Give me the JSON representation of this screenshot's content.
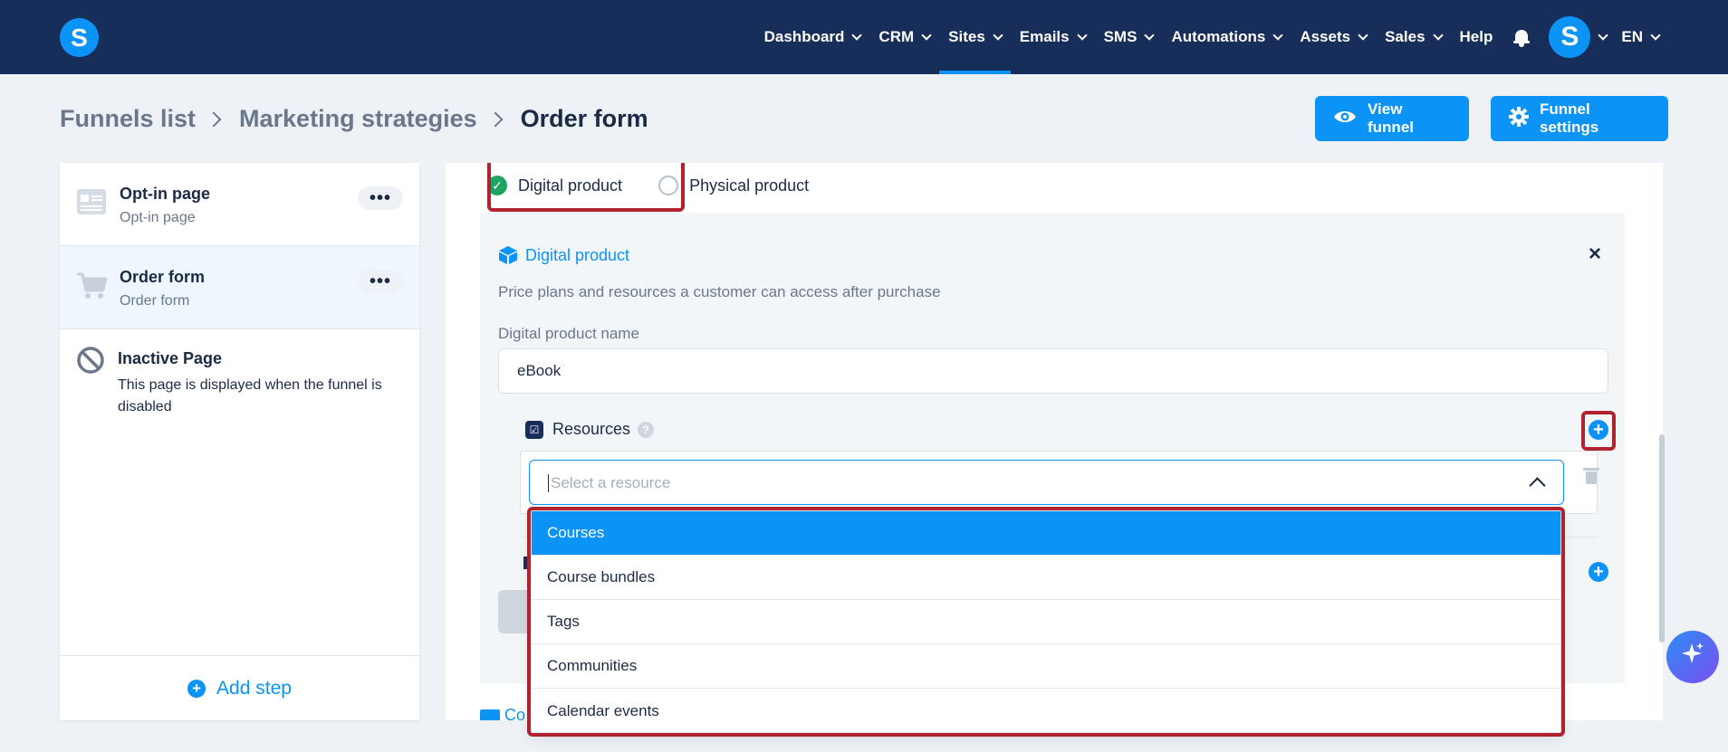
{
  "app": {
    "logo_letter": "S"
  },
  "nav": {
    "items": [
      {
        "label": "Dashboard",
        "dropdown": true
      },
      {
        "label": "CRM",
        "dropdown": true
      },
      {
        "label": "Sites",
        "dropdown": true,
        "active": true
      },
      {
        "label": "Emails",
        "dropdown": true
      },
      {
        "label": "SMS",
        "dropdown": true
      },
      {
        "label": "Automations",
        "dropdown": true
      },
      {
        "label": "Assets",
        "dropdown": true
      },
      {
        "label": "Sales",
        "dropdown": true
      },
      {
        "label": "Help",
        "dropdown": false
      }
    ],
    "avatar_letter": "S",
    "language": "EN"
  },
  "breadcrumb": {
    "items": [
      "Funnels list",
      "Marketing strategies"
    ],
    "current": "Order form"
  },
  "header": {
    "view_funnel": "View funnel",
    "funnel_settings": "Funnel settings"
  },
  "sidebar": {
    "steps": [
      {
        "title": "Opt-in page",
        "subtitle": "Opt-in page",
        "icon": "page-icon",
        "menu": "•••"
      },
      {
        "title": "Order form",
        "subtitle": "Order form",
        "icon": "cart-icon",
        "menu": "•••",
        "selected": true
      },
      {
        "title": "Inactive Page",
        "subtitle": "This page is displayed when the funnel is disabled",
        "icon": "ban-icon"
      }
    ],
    "add_step": "Add step"
  },
  "product_type": {
    "options": [
      "Digital product",
      "Physical product"
    ],
    "selected": "Digital product"
  },
  "digital_product": {
    "heading": "Digital product",
    "description": "Price plans and resources a customer can access after purchase",
    "name_label": "Digital product name",
    "name_value": "eBook",
    "resources_label": "Resources",
    "help": "?",
    "select_placeholder": "Select a resource",
    "close": "×",
    "partial_link": "Co"
  },
  "dropdown": {
    "options": [
      "Courses",
      "Course bundles",
      "Tags",
      "Communities",
      "Calendar events"
    ],
    "highlighted": "Courses"
  },
  "colors": {
    "nav_bg": "#172d5a",
    "accent": "#0b93f6",
    "highlight_border": "#b0222e",
    "success": "#1fa463"
  }
}
